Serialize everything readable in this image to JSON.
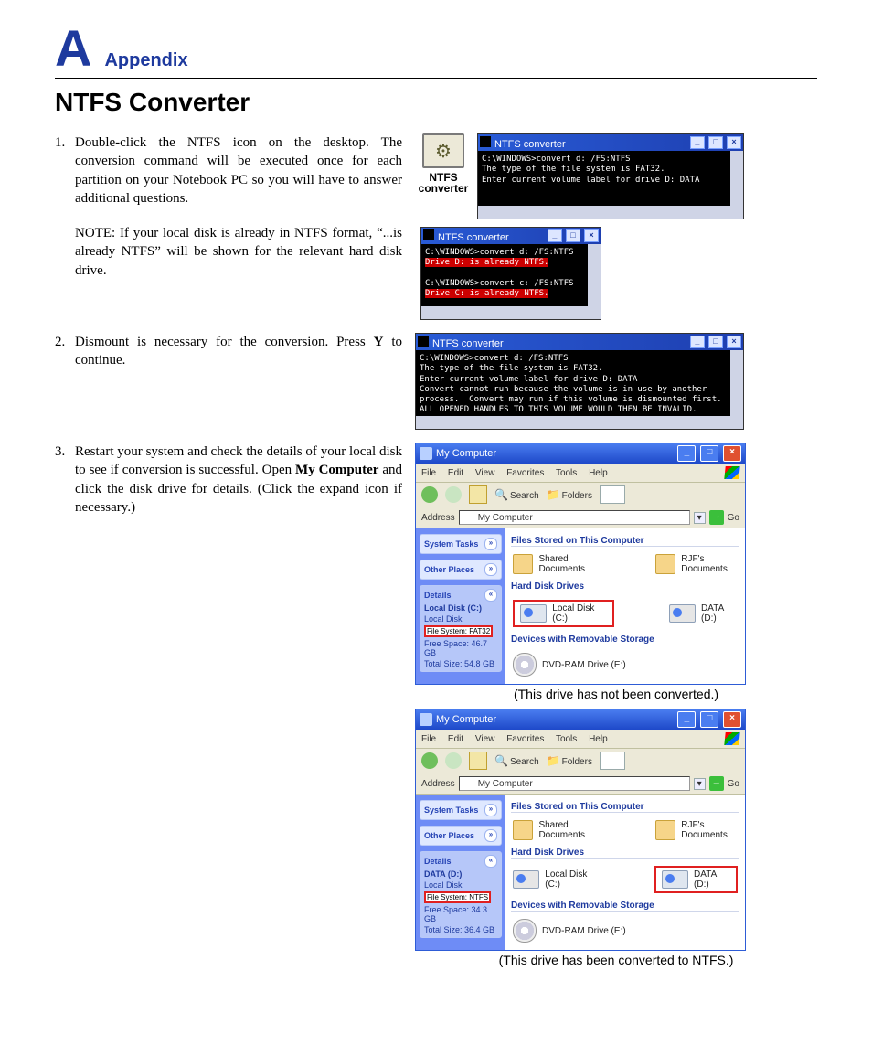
{
  "header": {
    "letter": "A",
    "label": "Appendix"
  },
  "title": "NTFS Converter",
  "steps": {
    "s1": {
      "num": "1.",
      "text": "Double-click the NTFS icon on the desktop. The conversion command will be executed once for each partition on your Notebook PC so you will have to answer additional questions.",
      "note": "NOTE: If your local disk is already in NTFS format, “...is already NTFS” will be shown for the relevant hard disk drive."
    },
    "s2": {
      "num": "2.",
      "text_a": "Dismount is necessary for the conversion. Press ",
      "bold": "Y",
      "text_b": " to continue."
    },
    "s3": {
      "num": "3.",
      "text_a": "Restart your system and check the details of your local disk to see if conversion is successful. Open ",
      "bold": "My Computer",
      "text_b": " and click the disk drive for details. (Click the expand icon if necessary.)"
    }
  },
  "iconLabel": {
    "l1": "NTFS",
    "l2": "converter"
  },
  "console": {
    "title": "NTFS converter",
    "btn_min": "_",
    "btn_max": "□",
    "btn_close": "×",
    "c1": "C:\\WINDOWS>convert d: /FS:NTFS\nThe type of the file system is FAT32.\nEnter current volume label for drive D: DATA",
    "c2a": "C:\\WINDOWS>convert d: /FS:NTFS",
    "c2b": "Drive D: is already NTFS.",
    "c2c": "C:\\WINDOWS>convert c: /FS:NTFS",
    "c2d": "Drive C: is already NTFS.",
    "c3": "C:\\WINDOWS>convert d: /FS:NTFS\nThe type of the file system is FAT32.\nEnter current volume label for drive D: DATA\nConvert cannot run because the volume is in use by another\nprocess.  Convert may run if this volume is dismounted first.\nALL OPENED HANDLES TO THIS VOLUME WOULD THEN BE INVALID.\nWould you like to force a dismount on this volume? (Y/N) Y"
  },
  "explorer": {
    "title": "My Computer",
    "menu": {
      "file": "File",
      "edit": "Edit",
      "view": "View",
      "fav": "Favorites",
      "tools": "Tools",
      "help": "Help"
    },
    "tool": {
      "search": "Search",
      "folders": "Folders"
    },
    "addr": {
      "label": "Address",
      "value": "My Computer",
      "go": "Go"
    },
    "side": {
      "tasks": "System Tasks",
      "other": "Other Places",
      "details": "Details"
    },
    "detA": {
      "l1": "Local Disk (C:)",
      "l2": "Local Disk",
      "l3": "File System: FAT32",
      "l4": "Free Space: 46.7 GB",
      "l5": "Total Size: 54.8 GB"
    },
    "detB": {
      "l1": "DATA (D:)",
      "l2": "Local Disk",
      "l3": "File System: NTFS",
      "l4": "Free Space: 34.3 GB",
      "l5": "Total Size: 36.4 GB"
    },
    "sect": {
      "files": "Files Stored on This Computer",
      "hdd": "Hard Disk Drives",
      "rem": "Devices with Removable Storage"
    },
    "items": {
      "shared": "Shared Documents",
      "userdocs": "RJF's Documents",
      "localC": "Local Disk (C:)",
      "dataD": "DATA (D:)",
      "dvd": "DVD-RAM Drive (E:)"
    }
  },
  "captions": {
    "a": "(This drive has not been converted.)",
    "b": "(This drive has been converted to NTFS.)"
  }
}
